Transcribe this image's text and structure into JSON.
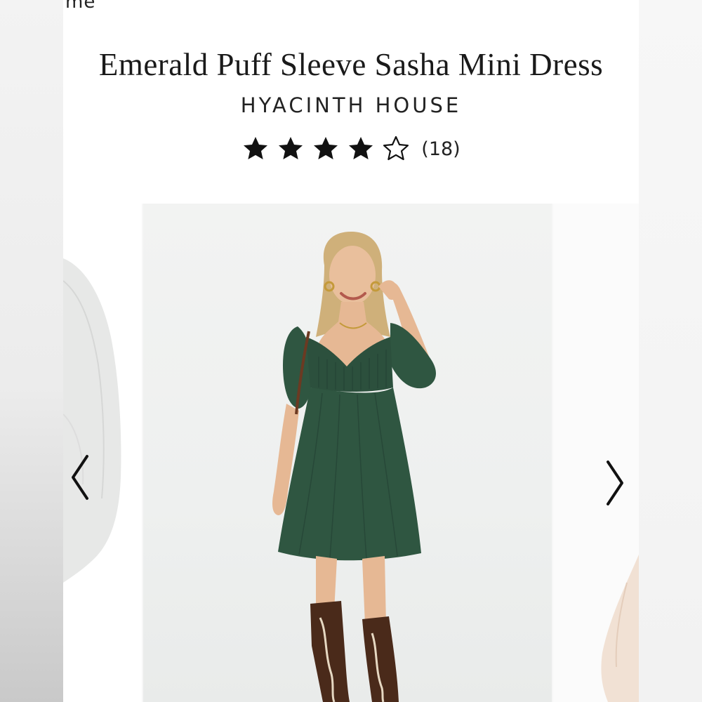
{
  "header": {
    "partial_text": "me"
  },
  "product": {
    "title": "Emerald Puff Sleeve Sasha Mini Dress",
    "brand": "HYACINTH HOUSE",
    "rating": {
      "stars": 4,
      "max_stars": 5,
      "review_count": "(18)"
    }
  },
  "gallery": {
    "main_image": "woman-in-green-mini-dress-and-cowboy-boots",
    "prev_icon": "chevron-left-icon",
    "next_icon": "chevron-right-icon",
    "dress_color": "#2f5641",
    "boot_color": "#4a2a1a"
  }
}
